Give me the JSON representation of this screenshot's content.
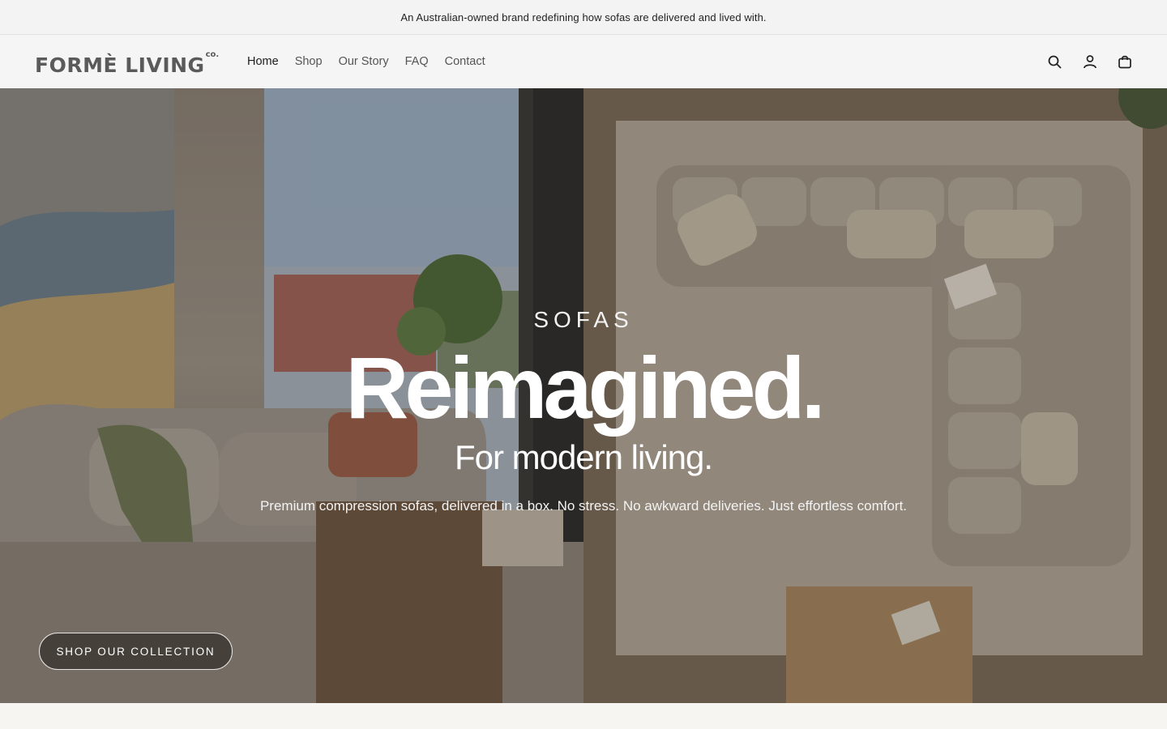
{
  "announcement": {
    "text": "An Australian-owned brand redefining how sofas are delivered and lived with."
  },
  "header": {
    "logo_text": "FORMÈ LIVING",
    "logo_suffix": "co.",
    "nav": [
      {
        "label": "Home"
      },
      {
        "label": "Shop"
      },
      {
        "label": "Our Story"
      },
      {
        "label": "FAQ"
      },
      {
        "label": "Contact"
      }
    ],
    "icons": [
      "search-icon",
      "account-icon",
      "cart-icon"
    ]
  },
  "hero": {
    "eyebrow": "SOFAS",
    "title": "Reimagined.",
    "subtitle": "For modern living.",
    "body": "Premium compression sofas, delivered in a box. No stress. No awkward deliveries. Just effortless comfort.",
    "cta_label": "SHOP OUR COLLECTION"
  },
  "colors": {
    "announcement_bg": "#f3f3f3",
    "header_bg": "#f5f5f5",
    "logo": "#5a5a5a",
    "hero_text": "#ffffff"
  }
}
